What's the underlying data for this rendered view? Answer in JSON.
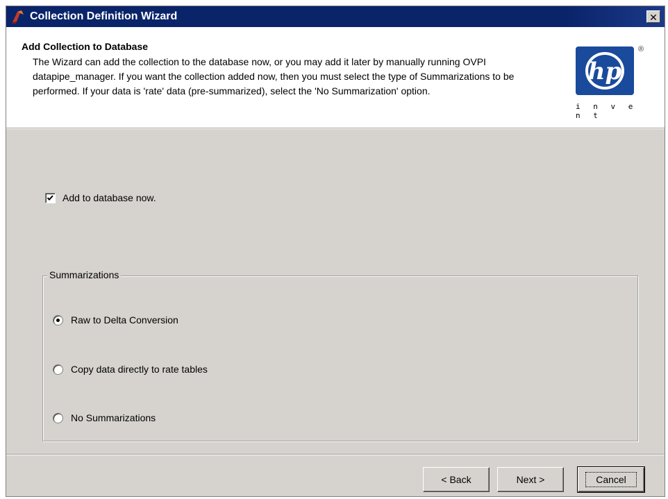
{
  "window": {
    "title": "Collection Definition Wizard",
    "close_glyph": "✕"
  },
  "header": {
    "title": "Add Collection to Database",
    "description": "The Wizard can add the collection to the database now, or you may add it later by manually running OVPI datapipe_manager. If you want the collection added now, then you must select the type of Summarizations to be performed. If your data is 'rate' data (pre-summarized), select the 'No Summarization' option.",
    "logo": {
      "brand": "hp",
      "registered": "®",
      "tagline": "i n v e n t",
      "color": "#1a4a9c"
    }
  },
  "add_now": {
    "label": "Add to database now.",
    "checked": true
  },
  "summarizations": {
    "legend": "Summarizations",
    "options": [
      {
        "label": "Raw to Delta Conversion",
        "selected": true
      },
      {
        "label": "Copy data directly to rate tables",
        "selected": false
      },
      {
        "label": "No Summarizations",
        "selected": false
      }
    ]
  },
  "buttons": {
    "back": "< Back",
    "next": "Next >",
    "cancel": "Cancel"
  },
  "icons": {
    "app": "wizard-app-icon",
    "close": "close-icon",
    "check": "checkmark-icon"
  }
}
